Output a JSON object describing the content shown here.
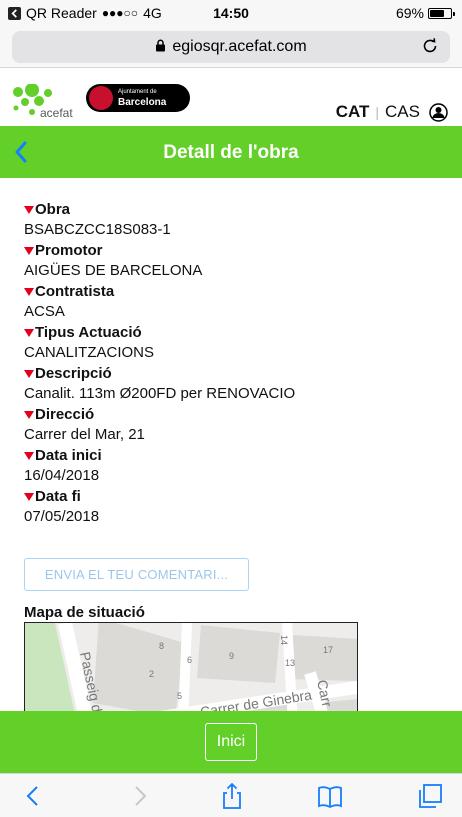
{
  "status_bar": {
    "app_name": "QR Reader",
    "signal": "●●●○○",
    "network": "4G",
    "time": "14:50",
    "battery_text": "69%",
    "battery_level": 0.69
  },
  "browser": {
    "url": "egiosqr.acefat.com"
  },
  "header": {
    "acefat_logo_text": "acefat",
    "bcn_logo_line1": "Ajuntament de",
    "bcn_logo_line2": "Barcelona",
    "lang_cat": "CAT",
    "lang_sep": "|",
    "lang_cas": "CAS"
  },
  "page": {
    "title": "Detall de l'obra"
  },
  "fields": [
    {
      "label": "Obra",
      "value": "BSABCZCC18S083-1"
    },
    {
      "label": "Promotor",
      "value": "AIGÜES DE BARCELONA"
    },
    {
      "label": "Contratista",
      "value": "ACSA"
    },
    {
      "label": "Tipus Actuació",
      "value": "CANALITZACIONS"
    },
    {
      "label": "Descripció",
      "value": "Canalit. 113m Ø200FD per RENOVACIO"
    },
    {
      "label": "Direcció",
      "value": "Carrer del Mar, 21"
    },
    {
      "label": "Data inici",
      "value": "16/04/2018"
    },
    {
      "label": "Data fi",
      "value": "07/05/2018"
    }
  ],
  "comment_button": "ENVIA EL TEU COMENTARI...",
  "map": {
    "title": "Mapa de situació",
    "street_passeig": "Passeig d",
    "street_ginebra": "Carrer de Ginebra",
    "street_carr": "Carr",
    "numbers": [
      "8",
      "6",
      "2",
      "5",
      "9",
      "13",
      "14",
      "17"
    ]
  },
  "footer": {
    "inici": "Inici"
  },
  "colors": {
    "green": "#63cf29",
    "red_triangle": "#e3001b",
    "ios_blue": "#157efb"
  }
}
